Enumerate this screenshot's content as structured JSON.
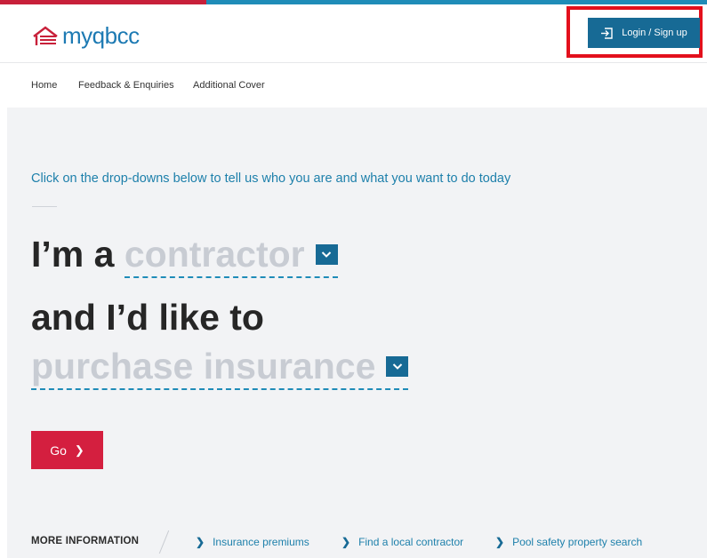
{
  "brand": {
    "logo_text": "myqbcc",
    "accent": "#1d7ab3",
    "red": "#d41f3f"
  },
  "header": {
    "login_label": "Login / Sign up",
    "login_icon": "login-icon"
  },
  "nav": {
    "items": [
      "Home",
      "Feedback & Enquiries",
      "Additional Cover"
    ]
  },
  "hero": {
    "intro": "Click on the drop-downs below to tell us who you are and what you want to do today",
    "line1_prefix": "I’m a",
    "role_selected": "contractor",
    "line2": "and I’d like to",
    "action_selected": "purchase insurance",
    "go_label": "Go"
  },
  "more_info": {
    "heading": "MORE INFORMATION",
    "links": [
      "Insurance premiums",
      "Find a local contractor",
      "Pool safety property search"
    ]
  }
}
